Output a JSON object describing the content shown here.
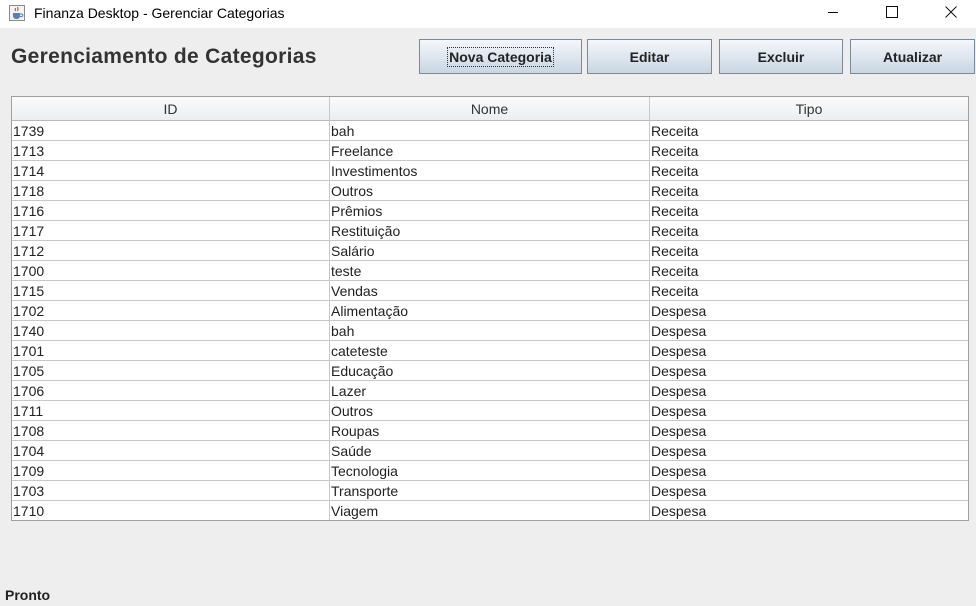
{
  "window": {
    "title": "Finanza Desktop - Gerenciar Categorias"
  },
  "header": {
    "title": "Gerenciamento de Categorias"
  },
  "toolbar": {
    "new_label": "Nova Categoria",
    "edit_label": "Editar",
    "delete_label": "Excluir",
    "refresh_label": "Atualizar"
  },
  "table": {
    "columns": [
      "ID",
      "Nome",
      "Tipo"
    ],
    "rows": [
      [
        "1739",
        "bah",
        "Receita"
      ],
      [
        "1713",
        "Freelance",
        "Receita"
      ],
      [
        "1714",
        "Investimentos",
        "Receita"
      ],
      [
        "1718",
        "Outros",
        "Receita"
      ],
      [
        "1716",
        "Prêmios",
        "Receita"
      ],
      [
        "1717",
        "Restituição",
        "Receita"
      ],
      [
        "1712",
        "Salário",
        "Receita"
      ],
      [
        "1700",
        "teste",
        "Receita"
      ],
      [
        "1715",
        "Vendas",
        "Receita"
      ],
      [
        "1702",
        "Alimentação",
        "Despesa"
      ],
      [
        "1740",
        "bah",
        "Despesa"
      ],
      [
        "1701",
        "cateteste",
        "Despesa"
      ],
      [
        "1705",
        "Educação",
        "Despesa"
      ],
      [
        "1706",
        "Lazer",
        "Despesa"
      ],
      [
        "1711",
        "Outros",
        "Despesa"
      ],
      [
        "1708",
        "Roupas",
        "Despesa"
      ],
      [
        "1704",
        "Saúde",
        "Despesa"
      ],
      [
        "1709",
        "Tecnologia",
        "Despesa"
      ],
      [
        "1703",
        "Transporte",
        "Despesa"
      ],
      [
        "1710",
        "Viagem",
        "Despesa"
      ]
    ]
  },
  "status": {
    "text": "Pronto"
  },
  "icons": {
    "app": "java-cup-icon",
    "minimize": "minimize-icon",
    "maximize": "maximize-icon",
    "close": "close-icon"
  }
}
